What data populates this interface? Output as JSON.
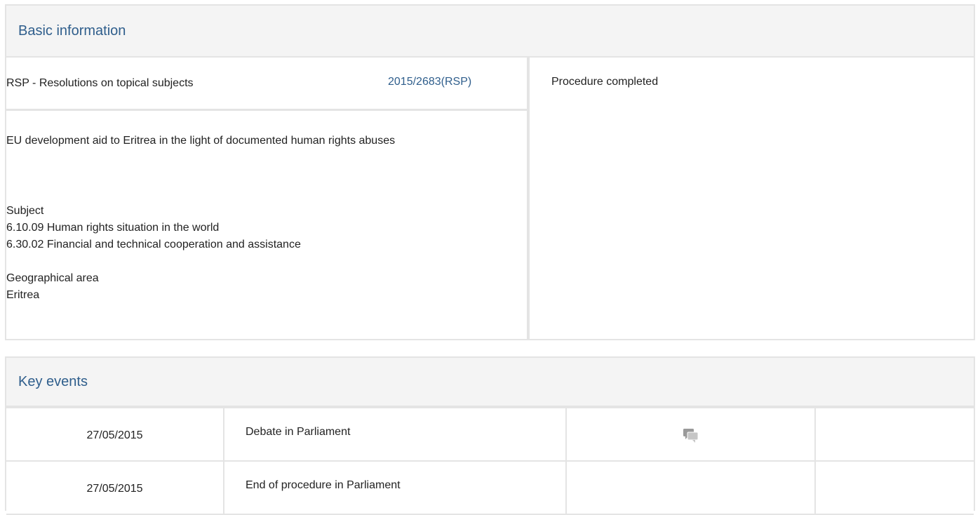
{
  "basic_info": {
    "header": "Basic information",
    "procedure_type": "RSP - Resolutions on topical subjects",
    "reference": "2015/2683(RSP)",
    "status": "Procedure completed",
    "title": "EU development aid to Eritrea in the light of documented human rights abuses",
    "subject_label": "Subject",
    "subjects": [
      "6.10.09 Human rights situation in the world",
      "6.30.02 Financial and technical cooperation and assistance"
    ],
    "geo_label": "Geographical area",
    "geo_value": "Eritrea"
  },
  "key_events": {
    "header": "Key events",
    "rows": [
      {
        "date": "27/05/2015",
        "event": "Debate in Parliament",
        "icon": "debate-icon"
      },
      {
        "date": "27/05/2015",
        "event": "End of procedure in Parliament",
        "icon": ""
      }
    ]
  },
  "colors": {
    "accent": "#2f5e8c",
    "border": "#e4e4e4",
    "header_bg": "#f4f4f4"
  }
}
